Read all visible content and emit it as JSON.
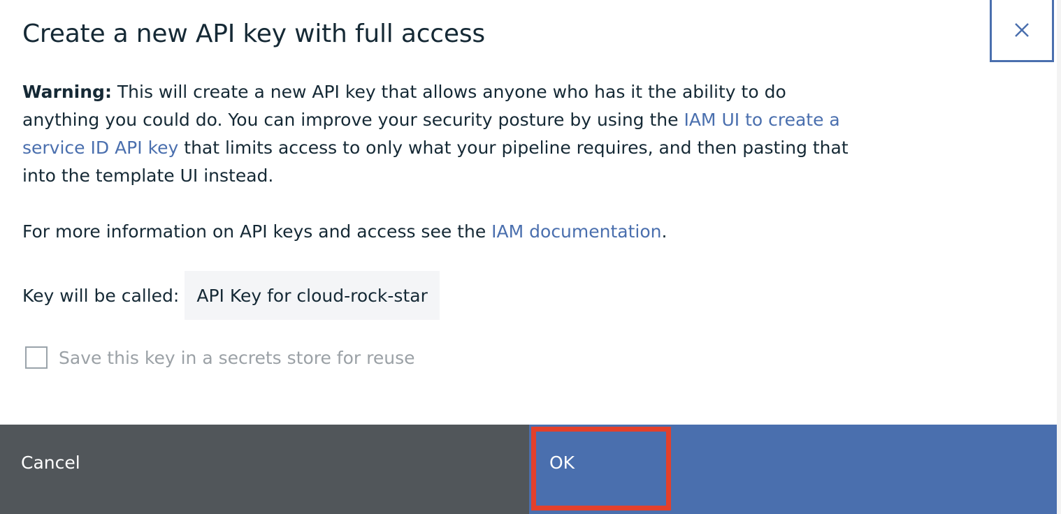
{
  "dialog": {
    "title": "Create a new API key with full access",
    "close_icon": "close-icon",
    "warning": {
      "label": "Warning:",
      "text_before_link": " This will create a new API key that allows anyone who has it the ability to do anything you could do. You can improve your security posture by using the ",
      "link_text": "IAM UI to create a service ID API key",
      "text_after_link": " that limits access to only what your pipeline requires, and then pasting that into the template UI instead."
    },
    "info": {
      "text_before_link": "For more information on API keys and access see the ",
      "link_text": "IAM documentation",
      "text_after_link": "."
    },
    "key_name": {
      "label": "Key will be called:",
      "value": "API Key for cloud-rock-star"
    },
    "save_option": {
      "label": "Save this key in a secrets store for reuse",
      "checked": false
    },
    "footer": {
      "cancel_label": "Cancel",
      "ok_label": "OK"
    }
  },
  "colors": {
    "text": "#152935",
    "link": "#4a6fae",
    "primary_button": "#4a6fae",
    "secondary_button": "#51565a",
    "highlight": "#e3402b",
    "disabled_text": "#9ba1a6"
  }
}
